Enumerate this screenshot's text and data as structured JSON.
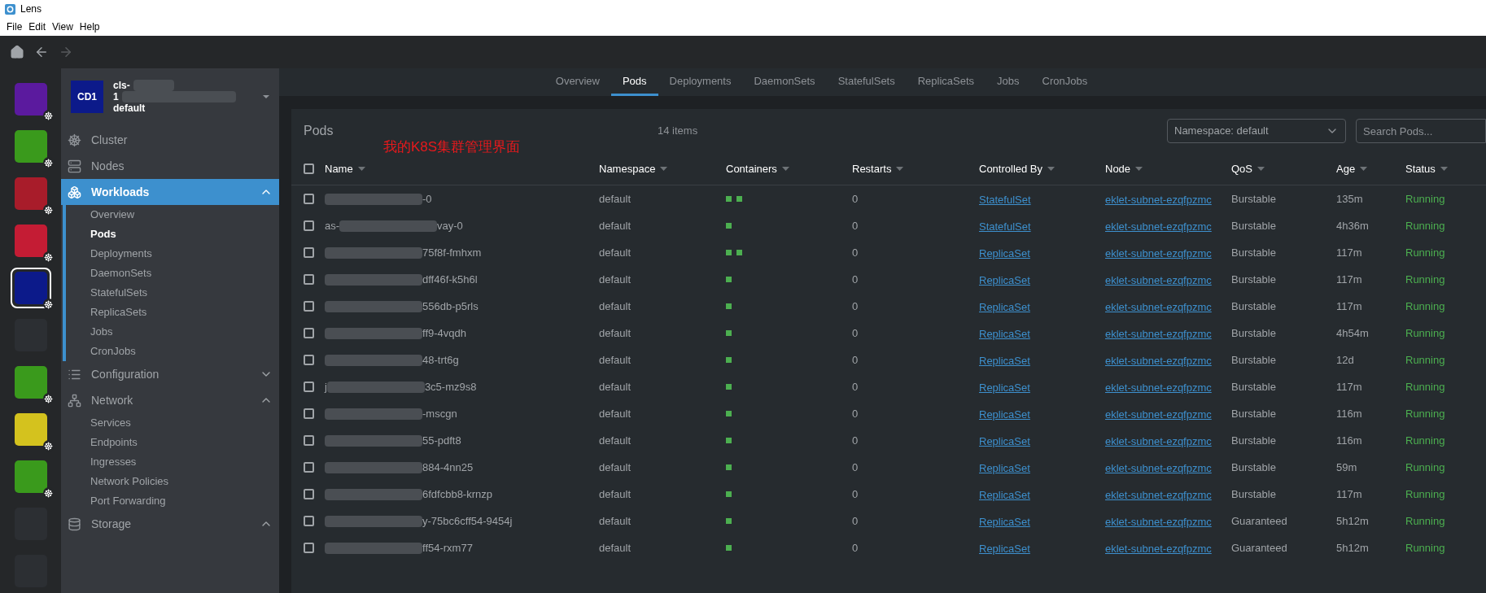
{
  "window": {
    "title": "Lens"
  },
  "menu": [
    "File",
    "Edit",
    "View",
    "Help"
  ],
  "toolbar": {
    "back_disabled": false,
    "forward_disabled": true
  },
  "clusters": [
    {
      "color": "#5b1a9e",
      "selected": false,
      "badge": true
    },
    {
      "color": "#3a9a1c",
      "selected": false,
      "badge": true
    },
    {
      "color": "#a81c2a",
      "selected": false,
      "badge": true
    },
    {
      "color": "#c41c34",
      "selected": false,
      "badge": true
    },
    {
      "color": "#0c1a8a",
      "selected": true,
      "badge": true
    },
    {
      "color": "#2c2f33",
      "selected": false,
      "badge": false
    },
    {
      "color": "#3a9a1c",
      "selected": false,
      "badge": true
    },
    {
      "color": "#d4c21e",
      "selected": false,
      "badge": true
    },
    {
      "color": "#3a9a1c",
      "selected": false,
      "badge": true
    },
    {
      "color": "#2c2f33",
      "selected": false,
      "badge": false
    },
    {
      "color": "#2c2f33",
      "selected": false,
      "badge": false
    }
  ],
  "cluster_header": {
    "avatar": "CD1",
    "name": "cls-",
    "line_2": "1",
    "context": "default"
  },
  "sidebar": {
    "items": [
      {
        "label": "Cluster",
        "kind": "link",
        "selected": false
      },
      {
        "label": "Nodes",
        "kind": "link",
        "selected": false
      },
      {
        "label": "Workloads",
        "kind": "group",
        "selected": true,
        "expanded": true,
        "children": [
          {
            "label": "Overview",
            "selected": false
          },
          {
            "label": "Pods",
            "selected": true
          },
          {
            "label": "Deployments",
            "selected": false
          },
          {
            "label": "DaemonSets",
            "selected": false
          },
          {
            "label": "StatefulSets",
            "selected": false
          },
          {
            "label": "ReplicaSets",
            "selected": false
          },
          {
            "label": "Jobs",
            "selected": false
          },
          {
            "label": "CronJobs",
            "selected": false
          }
        ]
      },
      {
        "label": "Configuration",
        "kind": "group",
        "selected": false,
        "expanded": false
      },
      {
        "label": "Network",
        "kind": "group",
        "selected": false,
        "expanded": true,
        "children": [
          {
            "label": "Services",
            "selected": false
          },
          {
            "label": "Endpoints",
            "selected": false
          },
          {
            "label": "Ingresses",
            "selected": false
          },
          {
            "label": "Network Policies",
            "selected": false
          },
          {
            "label": "Port Forwarding",
            "selected": false
          }
        ]
      },
      {
        "label": "Storage",
        "kind": "group",
        "selected": false,
        "expanded": true
      }
    ]
  },
  "tabs": [
    {
      "label": "Overview",
      "selected": false
    },
    {
      "label": "Pods",
      "selected": true
    },
    {
      "label": "Deployments",
      "selected": false
    },
    {
      "label": "DaemonSets",
      "selected": false
    },
    {
      "label": "StatefulSets",
      "selected": false
    },
    {
      "label": "ReplicaSets",
      "selected": false
    },
    {
      "label": "Jobs",
      "selected": false
    },
    {
      "label": "CronJobs",
      "selected": false
    }
  ],
  "panel": {
    "title": "Pods",
    "count": "14 items",
    "annotation": "我的K8S集群管理界面",
    "namespace_select": "Namespace: default",
    "search": {
      "placeholder": "Search Pods..."
    }
  },
  "table": {
    "all_selected": false,
    "columns": [
      "Name",
      "Namespace",
      "Containers",
      "Restarts",
      "Controlled By",
      "Node",
      "QoS",
      "Age",
      "Status"
    ],
    "rows": [
      {
        "selected": false,
        "name_start": "",
        "name_end": "-0",
        "namespace": "default",
        "containers": [
          {
            "color": "#4caf50"
          },
          {
            "color": "#4caf50"
          }
        ],
        "restarts": "0",
        "controlled_by": "StatefulSet",
        "node": "eklet-subnet-ezqfpzmc",
        "qos": "Burstable",
        "age": "135m",
        "status": "Running"
      },
      {
        "selected": false,
        "name_start": "as-",
        "name_end": "vay-0",
        "namespace": "default",
        "containers": [
          {
            "color": "#4caf50"
          }
        ],
        "restarts": "0",
        "controlled_by": "StatefulSet",
        "node": "eklet-subnet-ezqfpzmc",
        "qos": "Burstable",
        "age": "4h36m",
        "status": "Running"
      },
      {
        "selected": false,
        "name_start": "",
        "name_end": "75f8f-fmhxm",
        "namespace": "default",
        "containers": [
          {
            "color": "#4caf50"
          },
          {
            "color": "#4caf50"
          }
        ],
        "restarts": "0",
        "controlled_by": "ReplicaSet",
        "node": "eklet-subnet-ezqfpzmc",
        "qos": "Burstable",
        "age": "117m",
        "status": "Running"
      },
      {
        "selected": false,
        "name_start": "",
        "name_end": "dff46f-k5h6l",
        "namespace": "default",
        "containers": [
          {
            "color": "#4caf50"
          }
        ],
        "restarts": "0",
        "controlled_by": "ReplicaSet",
        "node": "eklet-subnet-ezqfpzmc",
        "qos": "Burstable",
        "age": "117m",
        "status": "Running"
      },
      {
        "selected": false,
        "name_start": "",
        "name_end": "556db-p5rls",
        "namespace": "default",
        "containers": [
          {
            "color": "#4caf50"
          }
        ],
        "restarts": "0",
        "controlled_by": "ReplicaSet",
        "node": "eklet-subnet-ezqfpzmc",
        "qos": "Burstable",
        "age": "117m",
        "status": "Running"
      },
      {
        "selected": false,
        "name_start": "",
        "name_end": "ff9-4vqdh",
        "namespace": "default",
        "containers": [
          {
            "color": "#4caf50"
          }
        ],
        "restarts": "0",
        "controlled_by": "ReplicaSet",
        "node": "eklet-subnet-ezqfpzmc",
        "qos": "Burstable",
        "age": "4h54m",
        "status": "Running"
      },
      {
        "selected": false,
        "name_start": "",
        "name_end": "48-trt6g",
        "namespace": "default",
        "containers": [
          {
            "color": "#4caf50"
          }
        ],
        "restarts": "0",
        "controlled_by": "ReplicaSet",
        "node": "eklet-subnet-ezqfpzmc",
        "qos": "Burstable",
        "age": "12d",
        "status": "Running"
      },
      {
        "selected": false,
        "name_start": "j",
        "name_end": "3c5-mz9s8",
        "namespace": "default",
        "containers": [
          {
            "color": "#4caf50"
          }
        ],
        "restarts": "0",
        "controlled_by": "ReplicaSet",
        "node": "eklet-subnet-ezqfpzmc",
        "qos": "Burstable",
        "age": "117m",
        "status": "Running"
      },
      {
        "selected": false,
        "name_start": "",
        "name_end": "-mscgn",
        "namespace": "default",
        "containers": [
          {
            "color": "#4caf50"
          }
        ],
        "restarts": "0",
        "controlled_by": "ReplicaSet",
        "node": "eklet-subnet-ezqfpzmc",
        "qos": "Burstable",
        "age": "116m",
        "status": "Running"
      },
      {
        "selected": false,
        "name_start": "",
        "name_end": "55-pdft8",
        "namespace": "default",
        "containers": [
          {
            "color": "#4caf50"
          }
        ],
        "restarts": "0",
        "controlled_by": "ReplicaSet",
        "node": "eklet-subnet-ezqfpzmc",
        "qos": "Burstable",
        "age": "116m",
        "status": "Running"
      },
      {
        "selected": false,
        "name_start": "",
        "name_end": "884-4nn25",
        "namespace": "default",
        "containers": [
          {
            "color": "#4caf50"
          }
        ],
        "restarts": "0",
        "controlled_by": "ReplicaSet",
        "node": "eklet-subnet-ezqfpzmc",
        "qos": "Burstable",
        "age": "59m",
        "status": "Running"
      },
      {
        "selected": false,
        "name_start": "",
        "name_end": "6fdfcbb8-krnzp",
        "namespace": "default",
        "containers": [
          {
            "color": "#4caf50"
          }
        ],
        "restarts": "0",
        "controlled_by": "ReplicaSet",
        "node": "eklet-subnet-ezqfpzmc",
        "qos": "Burstable",
        "age": "117m",
        "status": "Running"
      },
      {
        "selected": false,
        "name_start": "",
        "name_end": "y-75bc6cff54-9454j",
        "namespace": "default",
        "containers": [
          {
            "color": "#4caf50"
          }
        ],
        "restarts": "0",
        "controlled_by": "ReplicaSet",
        "node": "eklet-subnet-ezqfpzmc",
        "qos": "Guaranteed",
        "age": "5h12m",
        "status": "Running"
      },
      {
        "selected": false,
        "name_start": "",
        "name_end": "ff54-rxm77",
        "namespace": "default",
        "containers": [
          {
            "color": "#4caf50"
          }
        ],
        "restarts": "0",
        "controlled_by": "ReplicaSet",
        "node": "eklet-subnet-ezqfpzmc",
        "qos": "Guaranteed",
        "age": "5h12m",
        "status": "Running"
      }
    ]
  }
}
